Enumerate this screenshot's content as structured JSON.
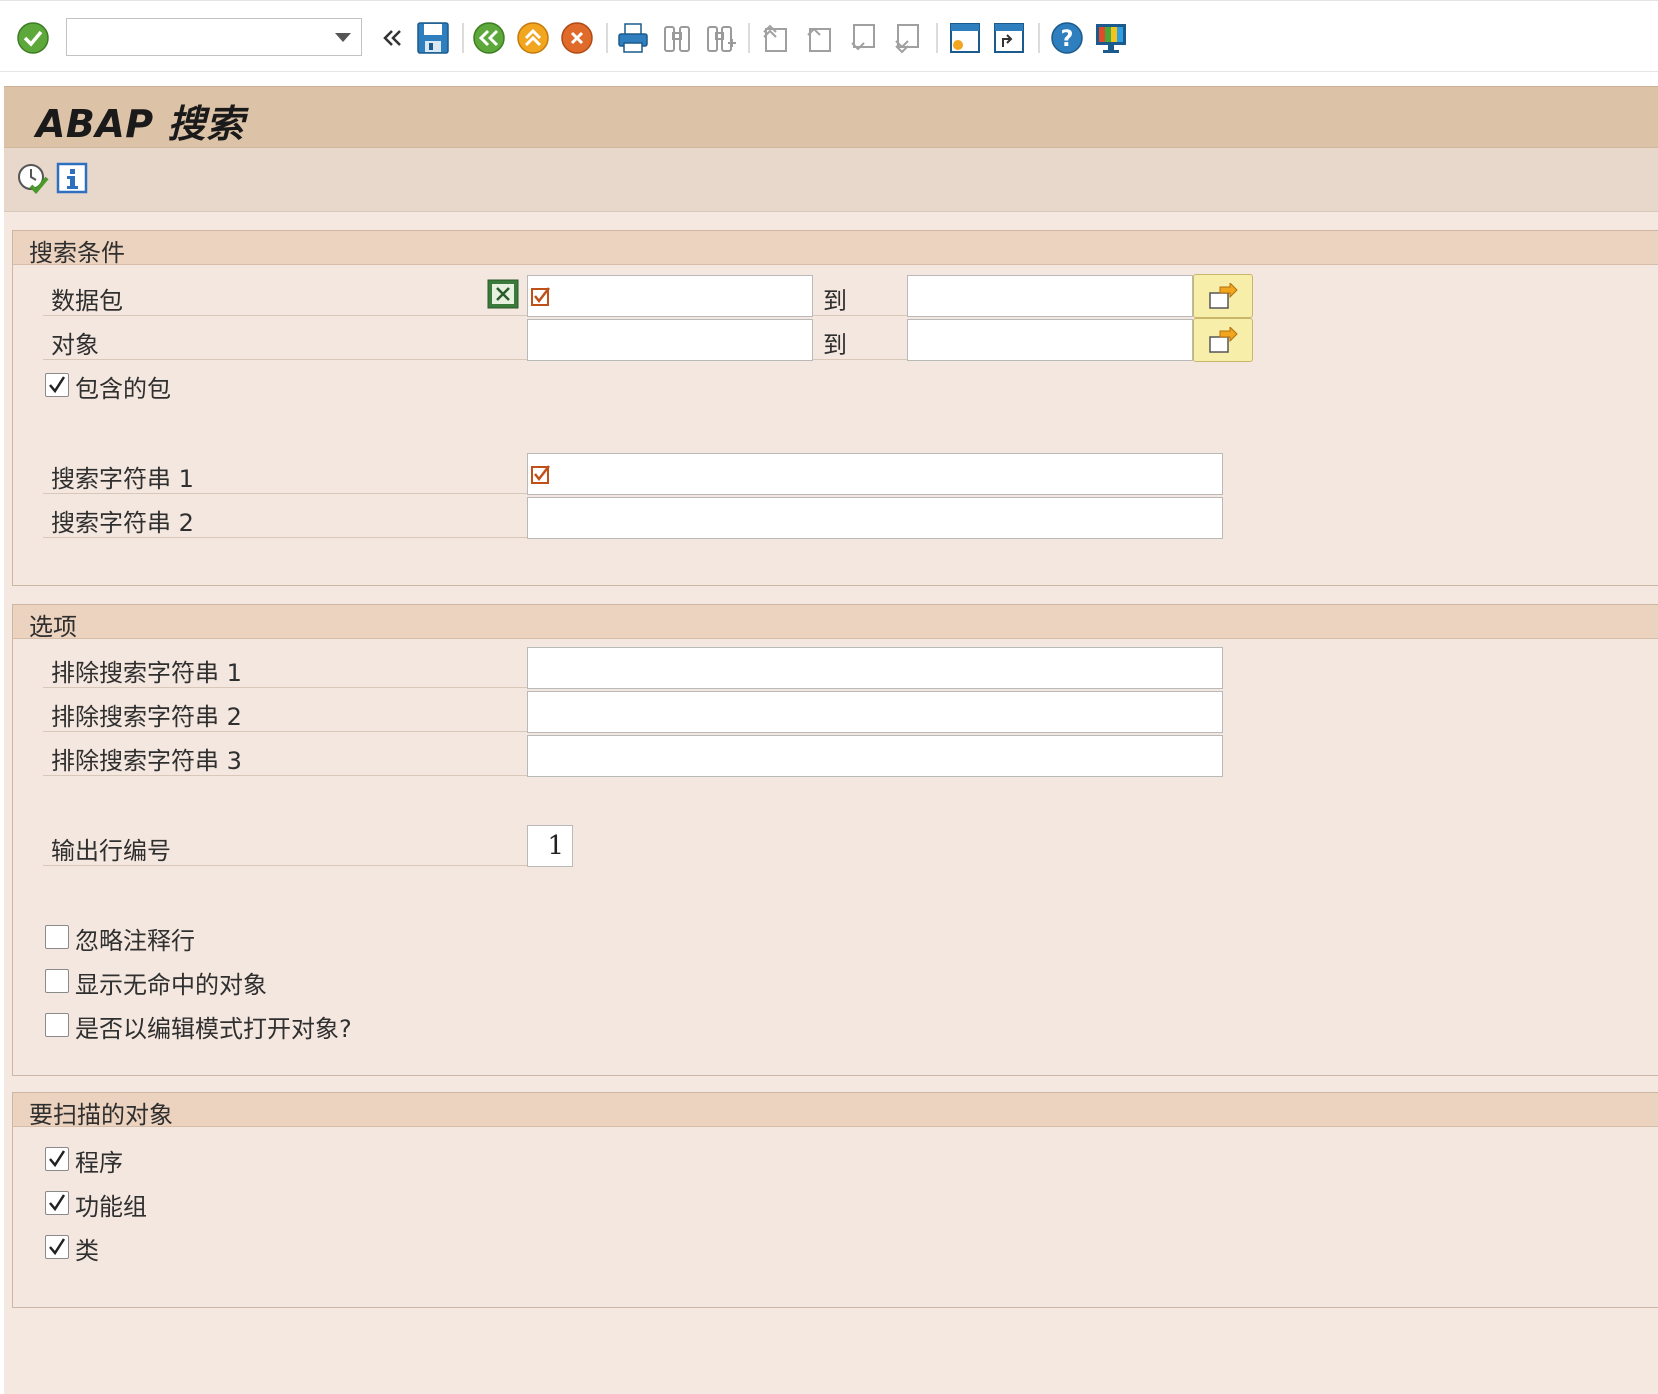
{
  "toolbar": {
    "command_field_value": "",
    "icons": [
      "enter-icon",
      "command-field-dropdown-icon",
      "collapse-icon",
      "save-icon",
      "back-icon",
      "exit-icon",
      "cancel-icon",
      "print-icon",
      "find-icon",
      "find-next-icon",
      "first-page-icon",
      "previous-page-icon",
      "next-page-icon",
      "last-page-icon",
      "create-session-icon",
      "create-shortcut-icon",
      "help-icon",
      "customize-layout-icon"
    ]
  },
  "title": "ABAP 搜索",
  "app_toolbar": {
    "icons": [
      "execute-icon",
      "info-icon"
    ]
  },
  "search_criteria": {
    "title": "搜索条件",
    "package": {
      "label": "数据包",
      "low": "",
      "to": "到",
      "high": ""
    },
    "object": {
      "label": "对象",
      "low": "",
      "to": "到",
      "high": ""
    },
    "include_subpackages": {
      "label": "包含的包",
      "checked": true
    },
    "search_string_1": {
      "label": "搜索字符串 1",
      "value": ""
    },
    "search_string_2": {
      "label": "搜索字符串 2",
      "value": ""
    }
  },
  "options": {
    "title": "选项",
    "exclude_1": {
      "label": "排除搜索字符串 1",
      "value": ""
    },
    "exclude_2": {
      "label": "排除搜索字符串 2",
      "value": ""
    },
    "exclude_3": {
      "label": "排除搜索字符串 3",
      "value": ""
    },
    "output_lines": {
      "label": "输出行编号",
      "value": "1"
    },
    "ignore_comments": {
      "label": "忽略注释行",
      "checked": false
    },
    "show_no_hit": {
      "label": "显示无命中的对象",
      "checked": false
    },
    "open_edit_mode": {
      "label": "是否以编辑模式打开对象?",
      "checked": false
    }
  },
  "objects_to_scan": {
    "title": "要扫描的对象",
    "programs": {
      "label": "程序",
      "checked": true
    },
    "function_groups": {
      "label": "功能组",
      "checked": true
    },
    "classes": {
      "label": "类",
      "checked": true
    }
  },
  "colors": {
    "title_bar": "#dcc2a6",
    "content_bg": "#f4e8e0",
    "group_header": "#ecd3bf",
    "multi_select_button": "#f7eea9",
    "required_marker": "#c0501a"
  }
}
